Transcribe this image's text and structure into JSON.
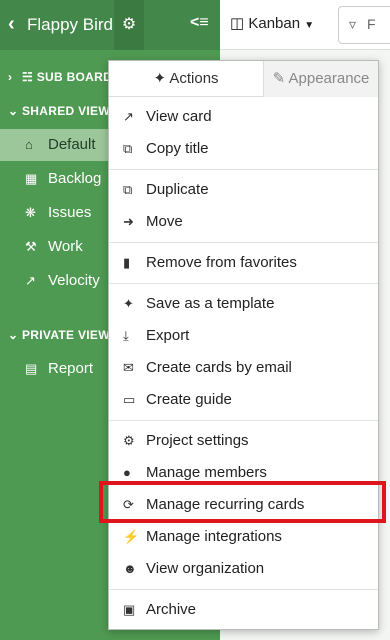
{
  "sidebar": {
    "title": "Flappy Bird",
    "back_icon": "chevron-left-icon",
    "gear_icon": "gear-icon",
    "collapse_icon": "collapse-sidebar-icon",
    "sections": {
      "sub_boards": "SUB BOARDS",
      "shared_views": "SHARED VIEWS",
      "private_views": "PRIVATE VIEWS"
    },
    "shared_items": [
      {
        "label": "Default",
        "icon": "home-icon"
      },
      {
        "label": "Backlog",
        "icon": "grid-icon"
      },
      {
        "label": "Issues",
        "icon": "bug-icon"
      },
      {
        "label": "Work",
        "icon": "wrench-icon"
      },
      {
        "label": "Velocity",
        "icon": "line-chart-icon"
      }
    ],
    "private_items": [
      {
        "label": "Report",
        "icon": "bar-chart-icon"
      }
    ]
  },
  "header": {
    "view_label": "Kanban",
    "filter_placeholder": "F"
  },
  "dropdown": {
    "tabs": {
      "actions": "Actions",
      "appearance": "Appearance"
    },
    "items": {
      "view_card": "View card",
      "copy_title": "Copy title",
      "duplicate": "Duplicate",
      "move": "Move",
      "remove_favorites": "Remove from favorites",
      "save_template": "Save as a template",
      "export": "Export",
      "create_cards_email": "Create cards by email",
      "create_guide": "Create guide",
      "project_settings": "Project settings",
      "manage_members": "Manage members",
      "manage_recurring": "Manage recurring cards",
      "manage_integrations": "Manage integrations",
      "view_organization": "View organization",
      "archive": "Archive"
    }
  },
  "colors": {
    "sidebar": "#4f9a52",
    "highlight": "#e0141d"
  }
}
